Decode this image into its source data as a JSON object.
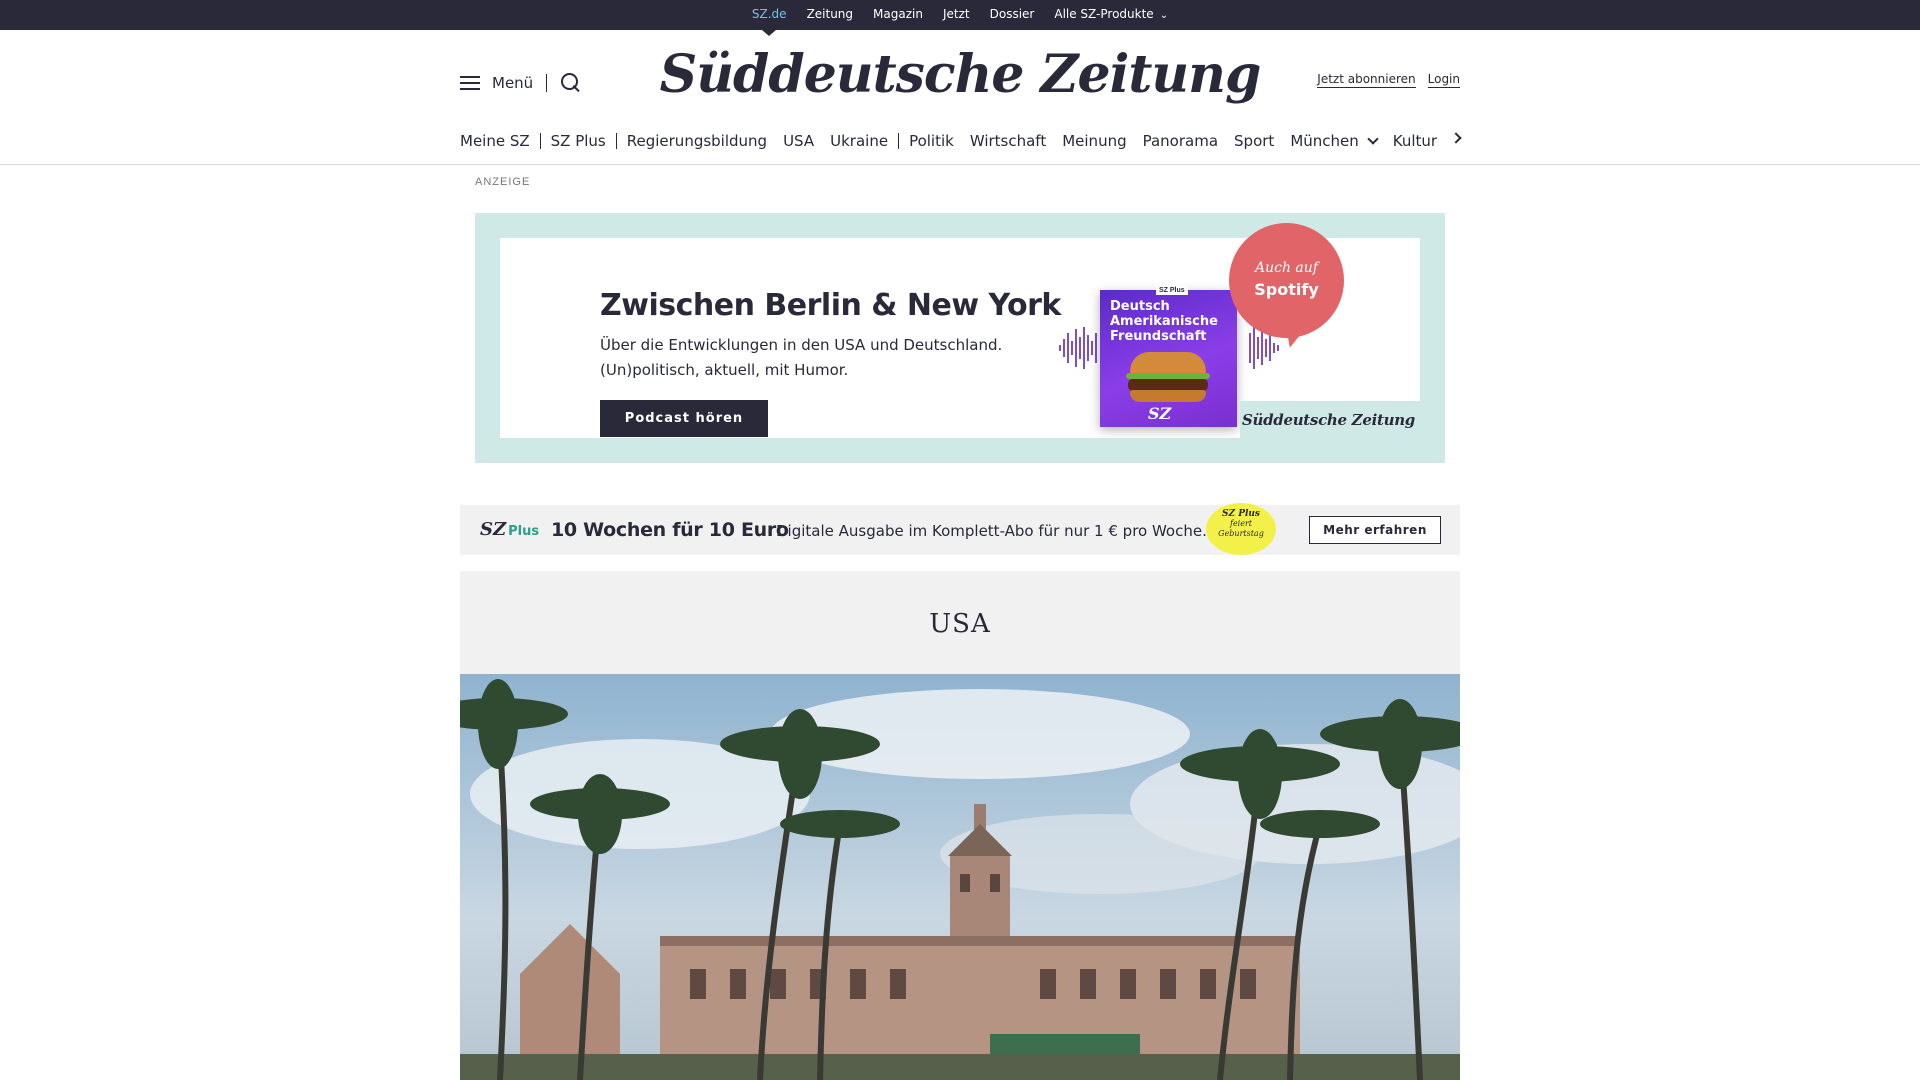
{
  "topbar": {
    "links": [
      "SZ.de",
      "Zeitung",
      "Magazin",
      "Jetzt",
      "Dossier",
      "Alle SZ-Produkte"
    ]
  },
  "header": {
    "menu_label": "Menü",
    "logo": "Süddeutsche Zeitung",
    "subscribe": "Jetzt abonnieren",
    "login": "Login"
  },
  "nav": {
    "items": [
      "Meine SZ",
      "SZ Plus",
      "Regierungsbildung",
      "USA",
      "Ukraine",
      "Politik",
      "Wirtschaft",
      "Meinung",
      "Panorama",
      "Sport",
      "München",
      "Kultur"
    ]
  },
  "ad": {
    "label": "ANZEIGE",
    "title": "Zwischen Berlin & New York",
    "text_line1": "Über die Entwicklungen in den USA und Deutschland.",
    "text_line2": "(Un)politisch, aktuell, mit Humor.",
    "button": "Podcast hören",
    "cover_tag": "SZ Plus",
    "cover_line1": "Deutsch",
    "cover_line2": "Amerikanische",
    "cover_line3": "Freundschaft",
    "cover_logo": "SZ",
    "bubble_line1": "Auch auf",
    "bubble_line2": "Spotify",
    "logo": "Süddeutsche Zeitung"
  },
  "plus": {
    "logo_sz": "SZ",
    "logo_plus": "Plus",
    "headline": "10 Wochen für 10 Euro",
    "text": "Digitale Ausgabe im Komplett-Abo für nur 1 € pro Woche.",
    "badge_line1": "SZ Plus",
    "badge_line2": "feiert",
    "badge_line3": "Geburtstag",
    "button": "Mehr erfahren"
  },
  "section": {
    "title": "USA"
  },
  "colors": {
    "ink": "#29293a",
    "active_link": "#71c5e8",
    "ad_frame": "#cfeae6",
    "spotify_bubble": "#e06468",
    "badge_yellow": "#f4f04a",
    "plus_green": "#2aa08a"
  }
}
